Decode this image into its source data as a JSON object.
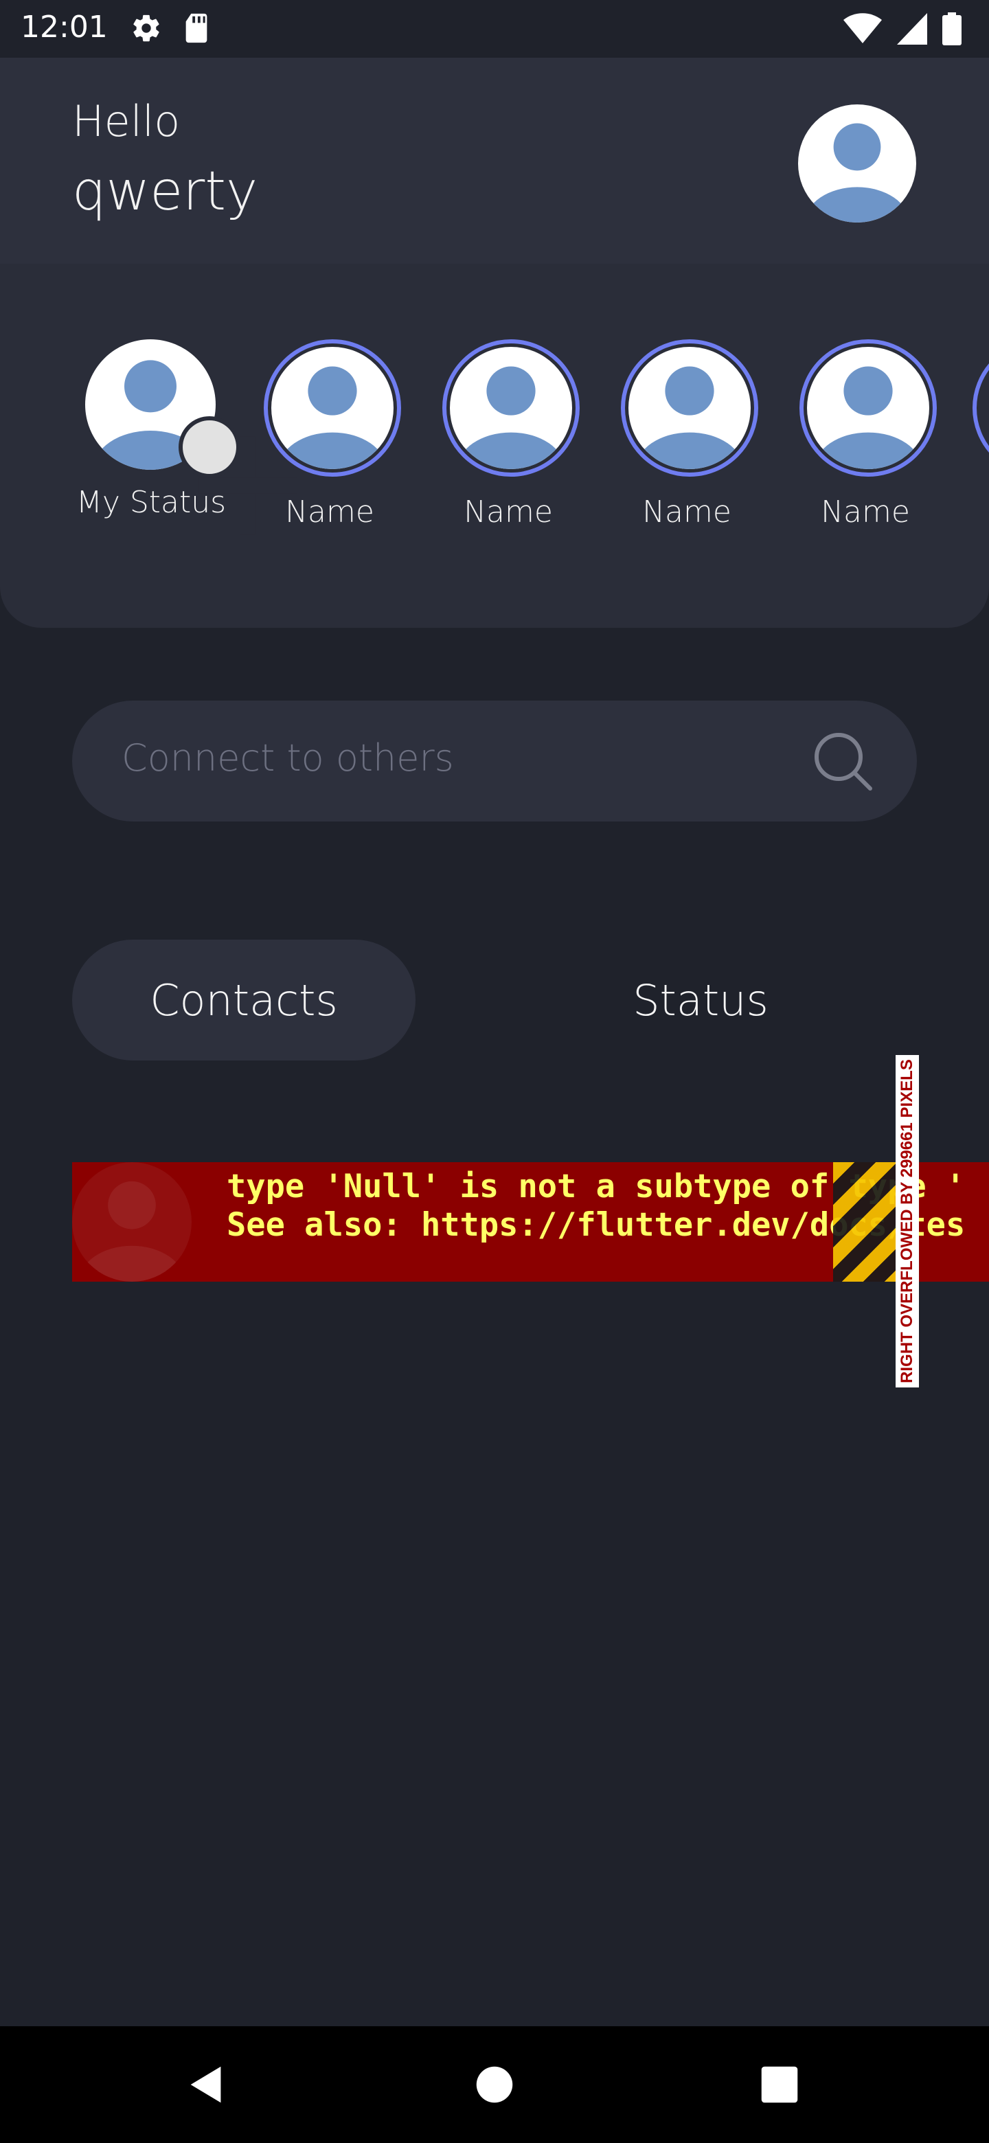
{
  "status_bar": {
    "time": "12:01",
    "left_icons": [
      "gear-icon",
      "sd-card-icon"
    ],
    "right_icons": [
      "wifi-icon",
      "cell-signal-icon",
      "battery-icon"
    ]
  },
  "header": {
    "greeting": "Hello",
    "username": "qwerty"
  },
  "stories": [
    {
      "label": "My Status",
      "mine": true
    },
    {
      "label": "Name",
      "mine": false
    },
    {
      "label": "Name",
      "mine": false
    },
    {
      "label": "Name",
      "mine": false
    },
    {
      "label": "Name",
      "mine": false
    }
  ],
  "search": {
    "placeholder": "Connect to others"
  },
  "tabs": [
    {
      "label": "Contacts",
      "active": true
    },
    {
      "label": "Status",
      "active": false
    }
  ],
  "error": {
    "line1": "type 'Null' is not a subtype of type '",
    "line2": "See also: https://flutter.dev/docs/tes",
    "overflow_label": "RIGHT OVERFLOWED BY 299661 PIXELS"
  },
  "colors": {
    "background": "#1f222b",
    "header": "#2d303d",
    "story_ring": "#6f7df0",
    "error_red": "#8b0000",
    "error_text": "#ffff66"
  }
}
